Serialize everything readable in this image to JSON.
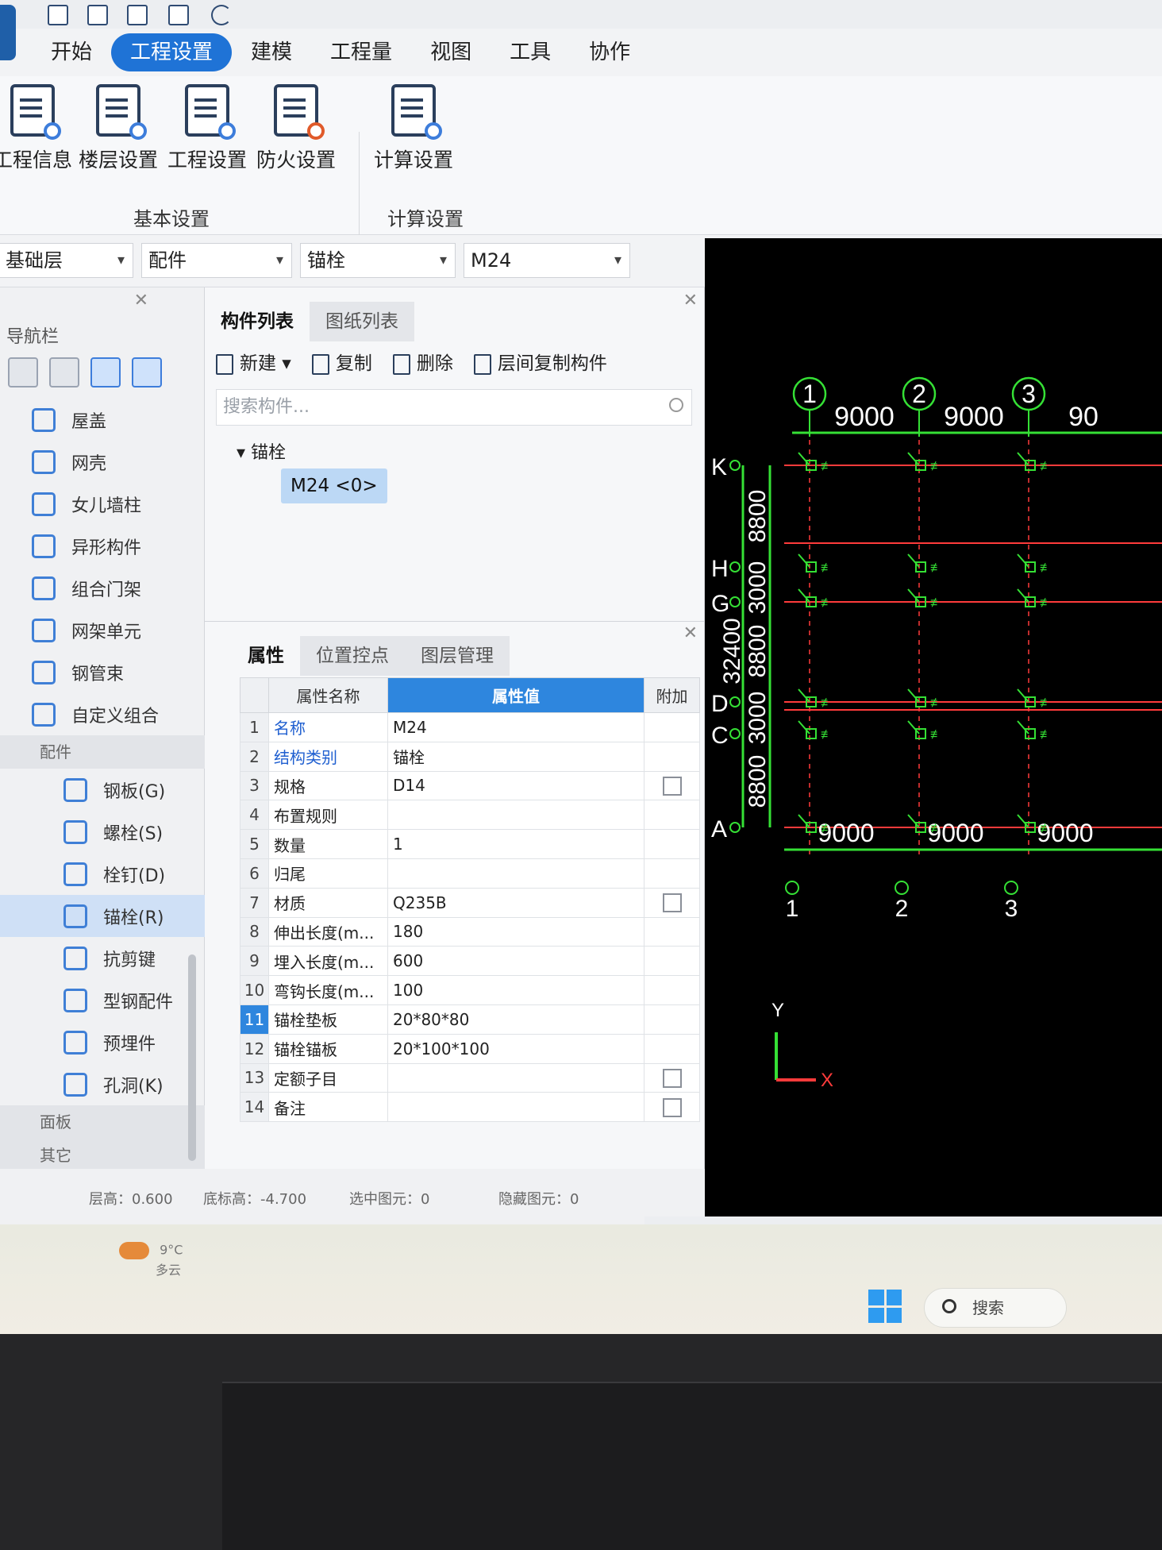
{
  "ribbon_tabs": [
    {
      "label": "开始",
      "active": false
    },
    {
      "label": "工程设置",
      "active": true
    },
    {
      "label": "建模",
      "active": false
    },
    {
      "label": "工程量",
      "active": false
    },
    {
      "label": "视图",
      "active": false
    },
    {
      "label": "工具",
      "active": false
    },
    {
      "label": "协作",
      "active": false
    }
  ],
  "ribbon": {
    "buttons": [
      "工程信息",
      "楼层设置",
      "工程设置",
      "防火设置",
      "计算设置"
    ],
    "group_basic": "基本设置",
    "group_calc": "计算设置"
  },
  "selectors": {
    "floor": "基础层",
    "category": "配件",
    "type": "锚栓",
    "component": "M24"
  },
  "nav": {
    "title": "导航栏",
    "items_top": [
      "屋盖",
      "网壳",
      "女儿墙柱",
      "异形构件",
      "组合门架",
      "网架单元",
      "钢管束",
      "自定义组合"
    ],
    "section_fittings": "配件",
    "items_fittings": [
      "钢板(G)",
      "螺栓(S)",
      "栓钉(D)",
      "锚栓(R)",
      "抗剪键",
      "型钢配件",
      "预埋件",
      "孔洞(K)"
    ],
    "selected": "锚栓(R)",
    "section_surface": "面板",
    "section_other": "其它"
  },
  "component_panel": {
    "tabs": [
      "构件列表",
      "图纸列表"
    ],
    "toolbar": {
      "new": "新建",
      "copy": "复制",
      "delete": "删除",
      "floor_copy": "层间复制构件"
    },
    "search_placeholder": "搜索构件...",
    "tree_root": "锚栓",
    "tree_leaf": "M24 <0>"
  },
  "property_panel": {
    "tabs": [
      "属性",
      "位置控点",
      "图层管理"
    ],
    "headers": {
      "name": "属性名称",
      "value": "属性值",
      "extra": "附加"
    },
    "rows": [
      {
        "no": "1",
        "name": "名称",
        "value": "M24",
        "checkbox": false,
        "blue": true
      },
      {
        "no": "2",
        "name": "结构类别",
        "value": "锚栓",
        "checkbox": false,
        "blue": true
      },
      {
        "no": "3",
        "name": "规格",
        "value": "D14",
        "checkbox": true,
        "blue": false
      },
      {
        "no": "4",
        "name": "布置规则",
        "value": "",
        "checkbox": false,
        "blue": false
      },
      {
        "no": "5",
        "name": "数量",
        "value": "1",
        "checkbox": false,
        "blue": false
      },
      {
        "no": "6",
        "name": "归尾",
        "value": "",
        "checkbox": false,
        "blue": false
      },
      {
        "no": "7",
        "name": "材质",
        "value": "Q235B",
        "checkbox": true,
        "blue": false
      },
      {
        "no": "8",
        "name": "伸出长度(m...",
        "value": "180",
        "checkbox": false,
        "blue": false
      },
      {
        "no": "9",
        "name": "埋入长度(m...",
        "value": "600",
        "checkbox": false,
        "blue": false
      },
      {
        "no": "10",
        "name": "弯钩长度(m...",
        "value": "100",
        "checkbox": false,
        "blue": false
      },
      {
        "no": "11",
        "name": "锚栓垫板",
        "value": "20*80*80",
        "checkbox": false,
        "blue": false
      },
      {
        "no": "12",
        "name": "锚栓锚板",
        "value": "20*100*100",
        "checkbox": false,
        "blue": false
      },
      {
        "no": "13",
        "name": "定额子目",
        "value": "",
        "checkbox": true,
        "blue": false
      },
      {
        "no": "14",
        "name": "备注",
        "value": "",
        "checkbox": true,
        "blue": false
      }
    ],
    "selected_row": "11"
  },
  "status": {
    "floor_height": "层高：0.600",
    "bottom_elev": "底标高：-4.700",
    "selected": "选中图元：0",
    "hidden": "隐藏图元：0"
  },
  "cad": {
    "top_axes": [
      "1",
      "2",
      "3"
    ],
    "bottom_axes": [
      "1",
      "2",
      "3"
    ],
    "top_dims": [
      "9000",
      "9000",
      "90"
    ],
    "bottom_dims": [
      "9000",
      "9000",
      "9000"
    ],
    "row_axes": [
      "K",
      "H",
      "G",
      "D",
      "C",
      "A"
    ],
    "vert_dims": [
      "8800",
      "3000",
      "8800",
      "3000",
      "8800"
    ],
    "total_dim": "32400",
    "ucs_y": "Y",
    "ucs_x": "X",
    "colors": {
      "axis": "#35e035",
      "red_line": "#ff3b3b",
      "background": "#000000"
    }
  },
  "taskbar": {
    "temp": "9°C",
    "weather": "多云",
    "search": "搜索"
  }
}
